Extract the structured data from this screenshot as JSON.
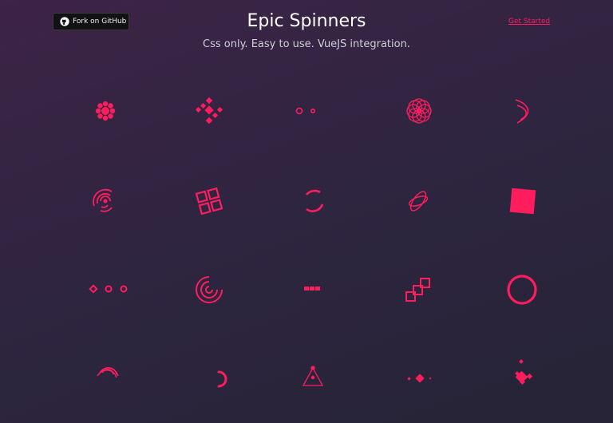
{
  "header": {
    "github_button_label": "Fork on GitHub",
    "title": "Epic Spinners",
    "subtitle": "Css only. Easy to use. VueJS integration.",
    "get_started_label": "Get Started"
  },
  "colors": {
    "accent": "#ff1d5e",
    "background_start": "#3d2346",
    "background_end": "#262436"
  },
  "spinners": [
    "fingerprint-spinner",
    "trinity-rings-spinner",
    "hollow-dots-spinner",
    "flower-spinner",
    "intersecting-circles-spinner",
    "radar-spinner",
    "swapping-squares-spinner",
    "semipolar-spinner",
    "orbit-spinner",
    "looping-rhombuses-spinner",
    "pixel-spinner",
    "spring-spinner",
    "circles-to-rhombuses-spinner",
    "self-building-square-spinner",
    "breeding-rhombus-spinner",
    "atom-spinner",
    "fulfilling-square-spinner",
    "scaling-squares-spinner",
    "half-circle-spinner",
    "rounded-semicircle-spinner"
  ]
}
